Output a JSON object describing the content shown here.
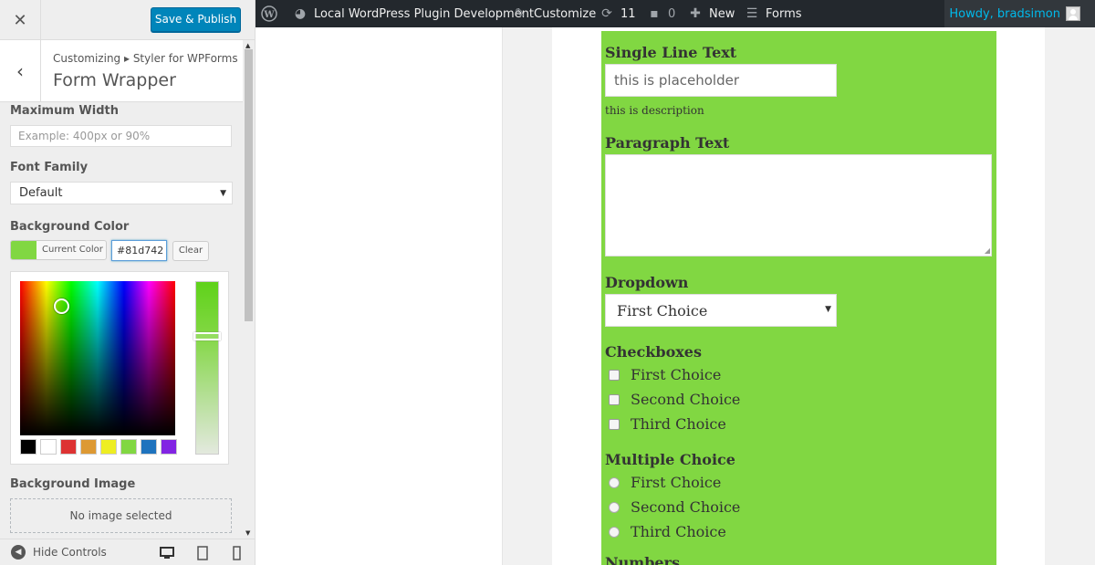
{
  "sidebar": {
    "close_icon": "close-icon",
    "save_label": "Save & Publish",
    "breadcrumb": "Customizing ▸ Styler for WPForms",
    "panel_title": "Form Wrapper",
    "max_width": {
      "label": "Maximum Width",
      "placeholder": "Example: 400px or 90%"
    },
    "font_family": {
      "label": "Font Family",
      "value": "Default"
    },
    "bg_color": {
      "label": "Background Color",
      "current_label": "Current Color",
      "hex_value": "#81d742",
      "clear_label": "Clear",
      "color": "#81d742",
      "palette": [
        "#000000",
        "#ffffff",
        "#dd3333",
        "#dd9933",
        "#eeee22",
        "#81d742",
        "#1e73be",
        "#8224e3"
      ]
    },
    "bg_image": {
      "label": "Background Image",
      "empty_text": "No image selected"
    },
    "footer": {
      "hide_label": "Hide Controls"
    }
  },
  "adminbar": {
    "site_name": "Local WordPress Plugin Development",
    "customize_label": "Customize",
    "updates_count": "11",
    "comments_count": "0",
    "new_label": "New",
    "forms_label": "Forms",
    "howdy": "Howdy, bradsimon"
  },
  "form": {
    "background": "#81d742",
    "single_line": {
      "label": "Single Line Text",
      "placeholder": "this is placeholder",
      "description": "this is description"
    },
    "paragraph": {
      "label": "Paragraph Text"
    },
    "dropdown": {
      "label": "Dropdown",
      "value": "First Choice"
    },
    "checkboxes": {
      "label": "Checkboxes",
      "options": [
        "First Choice",
        "Second Choice",
        "Third Choice"
      ]
    },
    "multiple_choice": {
      "label": "Multiple Choice",
      "options": [
        "First Choice",
        "Second Choice",
        "Third Choice"
      ]
    },
    "numbers": {
      "label": "Numbers"
    }
  }
}
